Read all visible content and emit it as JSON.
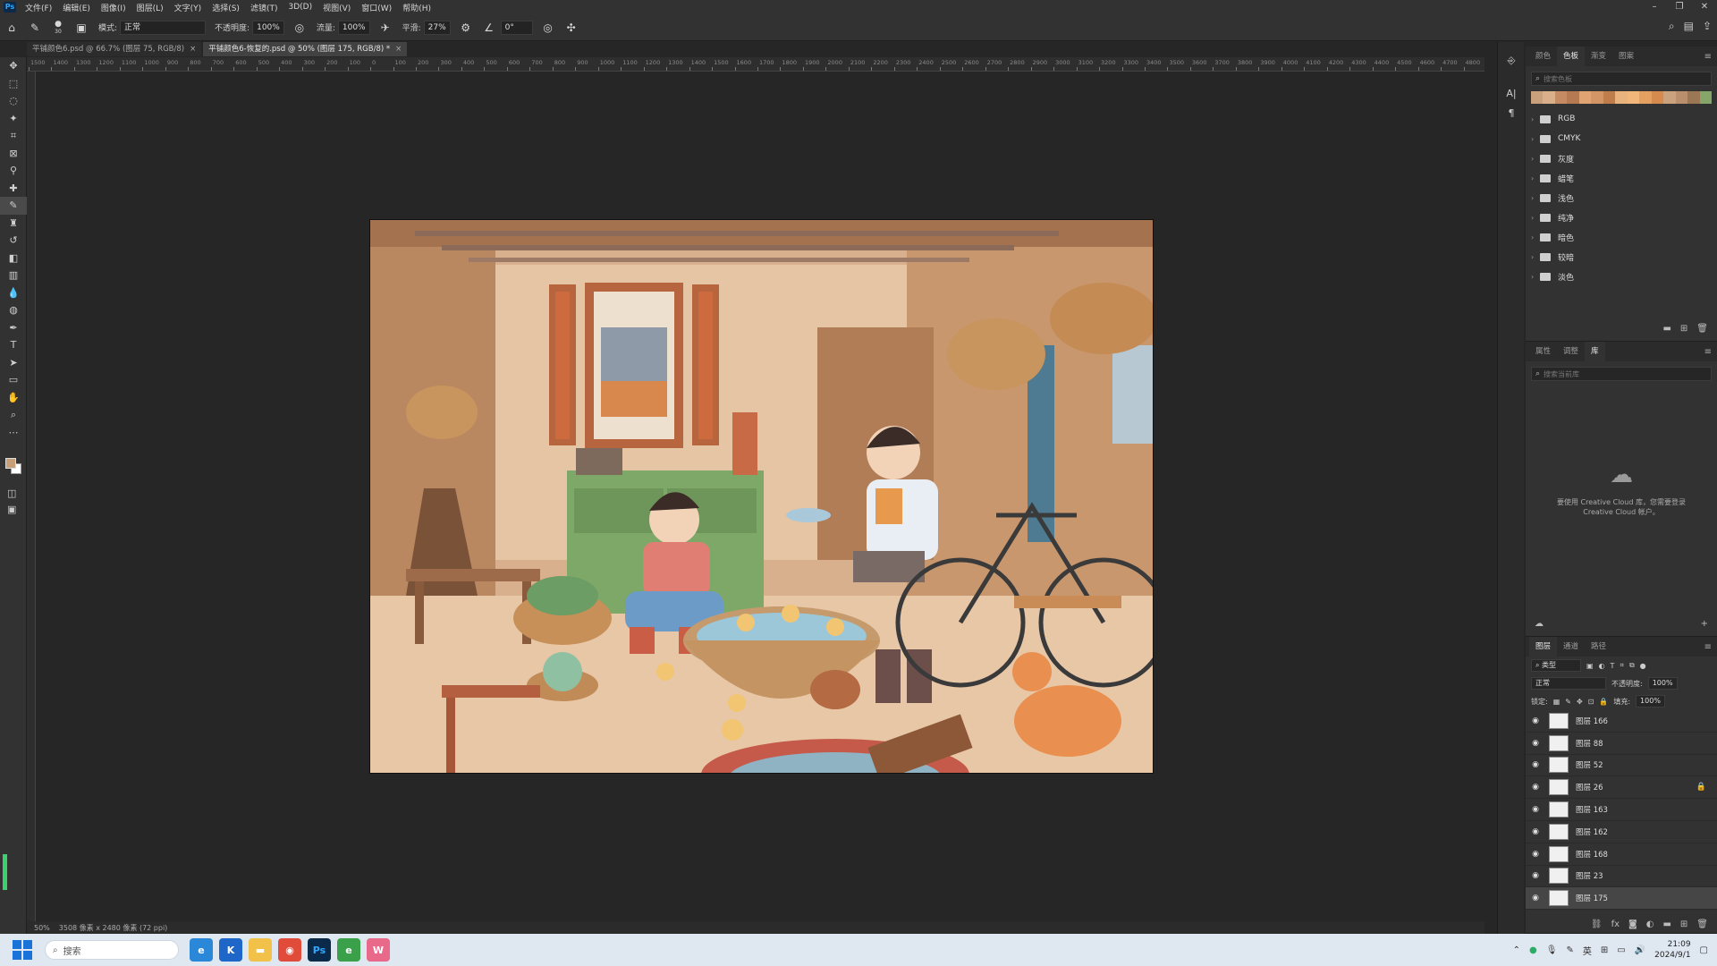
{
  "app": {
    "logo": "Ps"
  },
  "menubar": {
    "items": [
      "文件(F)",
      "编辑(E)",
      "图像(I)",
      "图层(L)",
      "文字(Y)",
      "选择(S)",
      "滤镜(T)",
      "3D(D)",
      "视图(V)",
      "窗口(W)",
      "帮助(H)"
    ],
    "window_buttons": [
      "–",
      "❐",
      "✕"
    ]
  },
  "options": {
    "brush_size": "30",
    "mode_label": "模式:",
    "mode_value": "正常",
    "opacity_label": "不透明度:",
    "opacity_value": "100%",
    "flow_label": "流量:",
    "flow_value": "100%",
    "smooth_label": "平滑:",
    "smooth_value": "27%",
    "angle_value": "0°"
  },
  "tabs": [
    {
      "label": "平铺颜色6.psd @ 66.7% (图层 75, RGB/8)",
      "close": "×"
    },
    {
      "label": "平铺颜色6-恢复的.psd @ 50% (图层 175, RGB/8) *",
      "close": "×"
    }
  ],
  "ruler": {
    "ticks": [
      "1500",
      "1400",
      "1300",
      "1200",
      "1100",
      "1000",
      "900",
      "800",
      "700",
      "600",
      "500",
      "400",
      "300",
      "200",
      "100",
      "0",
      "100",
      "200",
      "300",
      "400",
      "500",
      "600",
      "700",
      "800",
      "900",
      "1000",
      "1100",
      "1200",
      "1300",
      "1400",
      "1500",
      "1600",
      "1700",
      "1800",
      "1900",
      "2000",
      "2100",
      "2200",
      "2300",
      "2400",
      "2500",
      "2600",
      "2700",
      "2800",
      "2900",
      "3000",
      "3100",
      "3200",
      "3300",
      "3400",
      "3500",
      "3600",
      "3700",
      "3800",
      "3900",
      "4000",
      "4100",
      "4200",
      "4300",
      "4400",
      "4500",
      "4600",
      "4700",
      "4800"
    ]
  },
  "swatches_panel": {
    "tabs": [
      "颜色",
      "色板",
      "渐变",
      "图案"
    ],
    "active_tab": "色板",
    "search_placeholder": "搜索色板",
    "colors": [
      "#c9a07c",
      "#d9b08a",
      "#c58b62",
      "#b57a52",
      "#e0a472",
      "#d39566",
      "#c07d4c",
      "#e8b37c",
      "#f0b67a",
      "#e3a060",
      "#d68a4d",
      "#caa27d",
      "#b98f6d",
      "#9c7756",
      "#86a568"
    ],
    "groups": [
      "RGB",
      "CMYK",
      "灰度",
      "蜡笔",
      "浅色",
      "纯净",
      "暗色",
      "较暗",
      "淡色"
    ]
  },
  "library_panel": {
    "tabs": [
      "属性",
      "调整",
      "库"
    ],
    "active_tab": "库",
    "search_placeholder": "搜索当前库",
    "message": "要使用 Creative Cloud 库，您需要登录 Creative Cloud 帐户。"
  },
  "layers_panel": {
    "tabs": [
      "图层",
      "通道",
      "路径"
    ],
    "active_tab": "图层",
    "filter_label": "类型",
    "blend_mode": "正常",
    "opacity_label": "不透明度:",
    "opacity_value": "100%",
    "lock_label": "锁定:",
    "fill_label": "填充:",
    "fill_value": "100%",
    "layers": [
      {
        "name": "图层 166",
        "locked": false
      },
      {
        "name": "图层 88",
        "locked": false
      },
      {
        "name": "图层 52",
        "locked": false
      },
      {
        "name": "图层 26",
        "locked": true
      },
      {
        "name": "图层 163",
        "locked": false
      },
      {
        "name": "图层 162",
        "locked": false
      },
      {
        "name": "图层 168",
        "locked": false
      },
      {
        "name": "图层 23",
        "locked": false
      },
      {
        "name": "图层 175",
        "locked": false,
        "selected": true
      }
    ]
  },
  "status": {
    "zoom": "50%",
    "doc_size": "3508 像素 x 2480 像素 (72 ppi)"
  },
  "taskbar": {
    "search_placeholder": "搜索",
    "apps": [
      "edge-icon",
      "k-icon",
      "folder-icon",
      "chrome-icon",
      "photoshop-icon",
      "edge-dev-icon",
      "app-w-icon"
    ],
    "ime": "英",
    "time": "21:09",
    "date": "2024/9/1"
  },
  "colors": {
    "fg": "#c7a07a",
    "bg": "#ffffff",
    "accent": "#31a8ff"
  }
}
